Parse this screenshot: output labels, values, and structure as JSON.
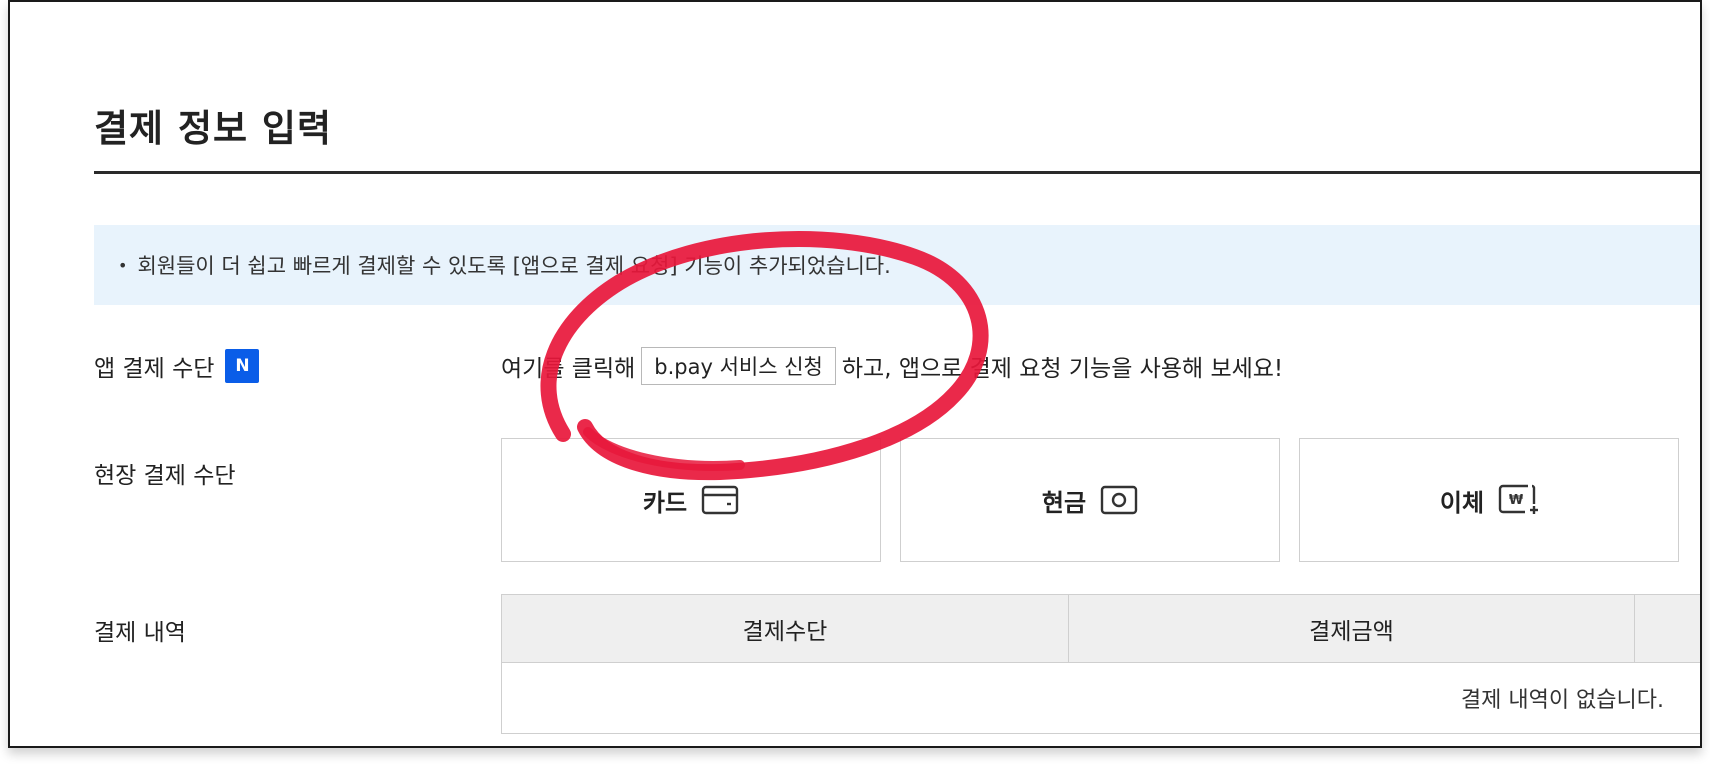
{
  "page": {
    "title": "결제 정보 입력",
    "notice": "회원들이 더 쉽고 빠르게 결제할 수 있도록 [앱으로 결제 요청] 기능이 추가되었습니다.",
    "notice_bullet": "•"
  },
  "app_payment": {
    "label": "앱 결제 수단",
    "badge": "N",
    "text_before": "여기를 클릭해",
    "button_label": "b.pay 서비스 신청",
    "text_after": "하고, 앱으로 결제 요청 기능을 사용해 보세요!"
  },
  "onsite_payment": {
    "label": "현장 결제 수단",
    "methods": [
      {
        "label": "카드",
        "icon": "card-icon"
      },
      {
        "label": "현금",
        "icon": "cash-icon"
      },
      {
        "label": "이체",
        "icon": "transfer-icon"
      }
    ]
  },
  "payment_history": {
    "label": "결제 내역",
    "columns": [
      "결제수단",
      "결제금액"
    ],
    "empty_message": "결제 내역이 없습니다."
  },
  "colors": {
    "accent_blue": "#0a5de8",
    "notice_bg": "#e8f3fc",
    "annotation_red": "#e8173b"
  }
}
